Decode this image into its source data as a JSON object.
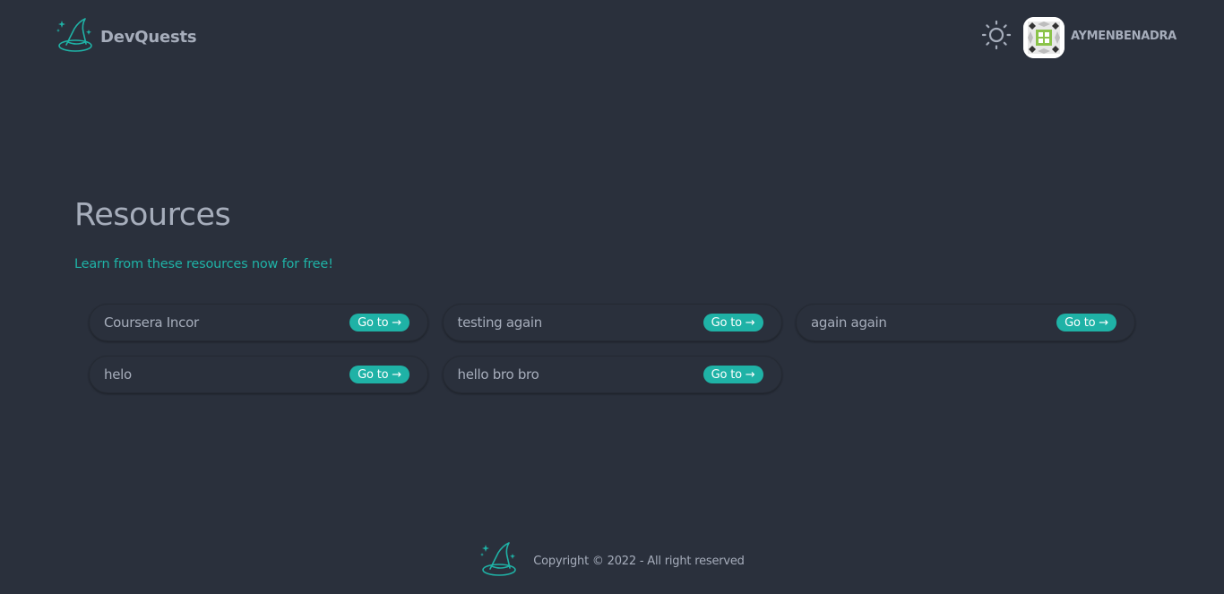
{
  "header": {
    "brand_name": "DevQuests",
    "logo_icon": "wizard-hat-icon",
    "theme_icon": "sun-icon",
    "username": "AYMENBENADRA"
  },
  "main": {
    "title": "Resources",
    "subtitle": "Learn from these resources now for free!",
    "resources": [
      {
        "name": "Coursera Incor",
        "button": "Go to →"
      },
      {
        "name": "testing again",
        "button": "Go to →"
      },
      {
        "name": "again again",
        "button": "Go to →"
      },
      {
        "name": "helo",
        "button": "Go to →"
      },
      {
        "name": "hello bro bro",
        "button": "Go to →"
      }
    ]
  },
  "footer": {
    "copyright": "Copyright © 2022 - All right reserved"
  },
  "colors": {
    "background": "#2a303c",
    "accent": "#1fb2a6",
    "text": "#a6adbb"
  }
}
